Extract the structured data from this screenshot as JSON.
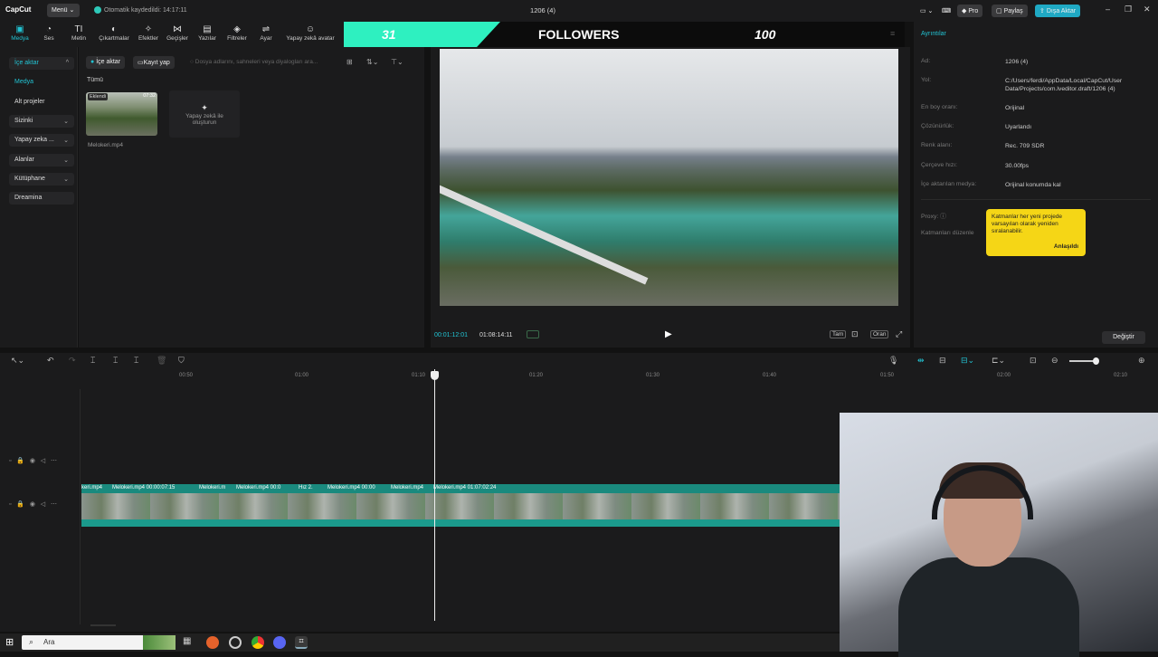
{
  "titlebar": {
    "logo": "CapCut",
    "menu": "Menü",
    "save_status": "Otomatik kaydedildi: 14:17:11",
    "project_title": "1206 (4)",
    "pro": "Pro",
    "share": "Paylaş",
    "export": "Dışa Aktar"
  },
  "toolbar": {
    "tools": [
      {
        "label": "Medya",
        "icon": "▣"
      },
      {
        "label": "Ses",
        "icon": "◔"
      },
      {
        "label": "Metin",
        "icon": "TI"
      },
      {
        "label": "Çıkartmalar",
        "icon": "◐"
      },
      {
        "label": "Efektler",
        "icon": "✧"
      },
      {
        "label": "Geçişler",
        "icon": "⋈"
      },
      {
        "label": "Yazılar",
        "icon": "▤"
      },
      {
        "label": "Filtreler",
        "icon": "◈"
      },
      {
        "label": "Ayar",
        "icon": "⇌"
      },
      {
        "label": "Yapay zekâ avatar",
        "icon": "☺"
      }
    ]
  },
  "banner": {
    "left_number": "31",
    "middle": "FOLLOWERS",
    "right_number": "100"
  },
  "sidebar": {
    "items": [
      {
        "label": "İçe aktar"
      },
      {
        "label": "Medya"
      },
      {
        "label": "Alt projeler"
      },
      {
        "label": "Sizinki"
      },
      {
        "label": "Yapay zeka ..."
      },
      {
        "label": "Alanlar"
      },
      {
        "label": "Kütüphane"
      },
      {
        "label": "Dreamina"
      }
    ]
  },
  "media": {
    "import_btn": "İçe aktar",
    "record_btn": "Kayıt yap",
    "search_placeholder": "Dosya adlarını, sahneleri veya diyalogları ara...",
    "filter_all": "Tümü",
    "clip_badge": "Eklendi",
    "clip_duration": "07:32",
    "clip_name": "Melokeri.mp4",
    "ai_tile": "Yapay zekâ ile oluşturun"
  },
  "player": {
    "current_time": "00:01:12:01",
    "total_time": "01:08:14:11",
    "btn_full": "Tam",
    "btn_ratio": "Oran"
  },
  "details": {
    "title": "Ayrıntılar",
    "rows": [
      {
        "key": "Ad:",
        "value": "1206 (4)"
      },
      {
        "key": "Yol:",
        "value": "C:/Users/ferdi/AppData/Local/CapCut/User Data/Projects/com.lveditor.draft/1206 (4)"
      },
      {
        "key": "En boy oranı:",
        "value": "Orijinal"
      },
      {
        "key": "Çözünürlük:",
        "value": "Uyarlandı"
      },
      {
        "key": "Renk alanı:",
        "value": "Rec. 709 SDR"
      },
      {
        "key": "Çerçeve hızı:",
        "value": "30.00fps"
      },
      {
        "key": "İçe aktarılan medya:",
        "value": "Orijinal konumda kal"
      }
    ],
    "proxy": "Proxy:",
    "layer": "Katmanları düzenle",
    "tooltip_text": "Katmanlar her yeni projede varsayılan olarak yeniden sıralanabilir.",
    "tooltip_ok": "Anlaşıldı",
    "change_btn": "Değiştir"
  },
  "timeline": {
    "ruler": [
      "00:50",
      "01:00",
      "01:10",
      "01:20",
      "01:30",
      "01:40",
      "01:50",
      "02:00",
      "02:10"
    ],
    "clip_labels": [
      "keri.mp4",
      "Melokeri.mp4  00:00:07:15",
      "Melokeri.m",
      "Melokeri.mp4  00:0",
      "Hız 2.",
      "Melokeri.mp4  00:00",
      "Melokeri.mp4",
      "Melokeri.mp4  01:07:02:24"
    ]
  },
  "taskbar": {
    "search": "Ara"
  }
}
